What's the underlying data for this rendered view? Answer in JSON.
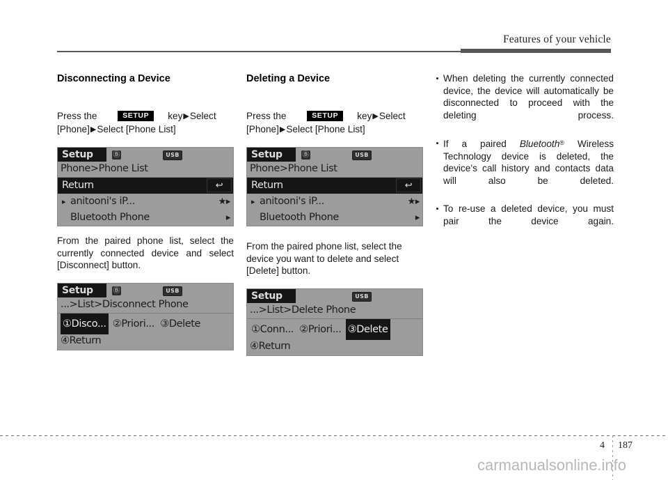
{
  "header": {
    "title": "Features of your vehicle"
  },
  "footer": {
    "chapter": "4",
    "page": "187",
    "watermark": "carmanualsonline.info"
  },
  "left_column": {
    "heading": "Disconnecting a Device",
    "instruction": {
      "before": "Press     the",
      "key_label": "SETUP",
      "after_key": "key",
      "arrow": "▶",
      "select1": "Select",
      "line2_a": "[Phone]",
      "line2_b": "Select [Phone List]"
    },
    "screen1": {
      "title": "Setup",
      "bt_icon": "bluetooth-icon",
      "usb_badge": "USB",
      "breadcrumb": "Phone>Phone List",
      "rows": [
        {
          "label": "Return",
          "highlight": true,
          "right": "↩"
        },
        {
          "label": "anitooni's iP...",
          "lead": "▸",
          "right": "★▸"
        },
        {
          "label": "Bluetooth Phone",
          "right": "▸"
        }
      ]
    },
    "caption": "From the paired phone list, select the currently connected device and select  [Disconnect] button.",
    "screen2": {
      "title": "Setup",
      "bt_icon": "bluetooth-icon",
      "usb_badge": "USB",
      "breadcrumb": "...>List>Disconnect Phone",
      "options": [
        {
          "num": "①",
          "label": "Disco...",
          "highlight": true
        },
        {
          "num": "②",
          "label": "Priori...",
          "highlight": false
        },
        {
          "num": "③",
          "label": "Delete",
          "highlight": false
        }
      ],
      "last_row": {
        "num": "④",
        "label": "Return"
      }
    }
  },
  "middle_column": {
    "heading": "Deleting a Device",
    "instruction": {
      "before": "Press     the",
      "key_label": "SETUP",
      "after_key": "key",
      "arrow": "▶",
      "select1": "Select",
      "line2_a": "[Phone]",
      "line2_b": "Select [Phone List]"
    },
    "screen1": {
      "title": "Setup",
      "bt_icon": "bluetooth-icon",
      "usb_badge": "USB",
      "breadcrumb": "Phone>Phone List",
      "rows": [
        {
          "label": "Return",
          "highlight": true,
          "right": "↩"
        },
        {
          "label": "anitooni's iP...",
          "lead": "▸",
          "right": "★▸"
        },
        {
          "label": "Bluetooth Phone",
          "right": "▸"
        }
      ]
    },
    "caption": "From the paired phone list, select the device you want to delete and select [Delete] button.",
    "screen2": {
      "title": "Setup",
      "usb_badge": "USB",
      "breadcrumb": "...>List>Delete Phone",
      "options": [
        {
          "num": "①",
          "label": "Conn...",
          "highlight": false
        },
        {
          "num": "②",
          "label": "Priori...",
          "highlight": false
        },
        {
          "num": "③",
          "label": "Delete",
          "highlight": true
        }
      ],
      "last_row": {
        "num": "④",
        "label": "Return"
      }
    }
  },
  "right_column": {
    "bullets": [
      {
        "text": "When deleting the currently connected device, the device will automatically be disconnected to proceed with the deleting process."
      },
      {
        "pre": "If a paired ",
        "italic": "Bluetooth",
        "reg": "®",
        "post": " Wireless Technology device is deleted, the device’s call history and contacts data will also be deleted."
      },
      {
        "text": "To re-use a deleted device, you must pair the device again."
      }
    ]
  }
}
